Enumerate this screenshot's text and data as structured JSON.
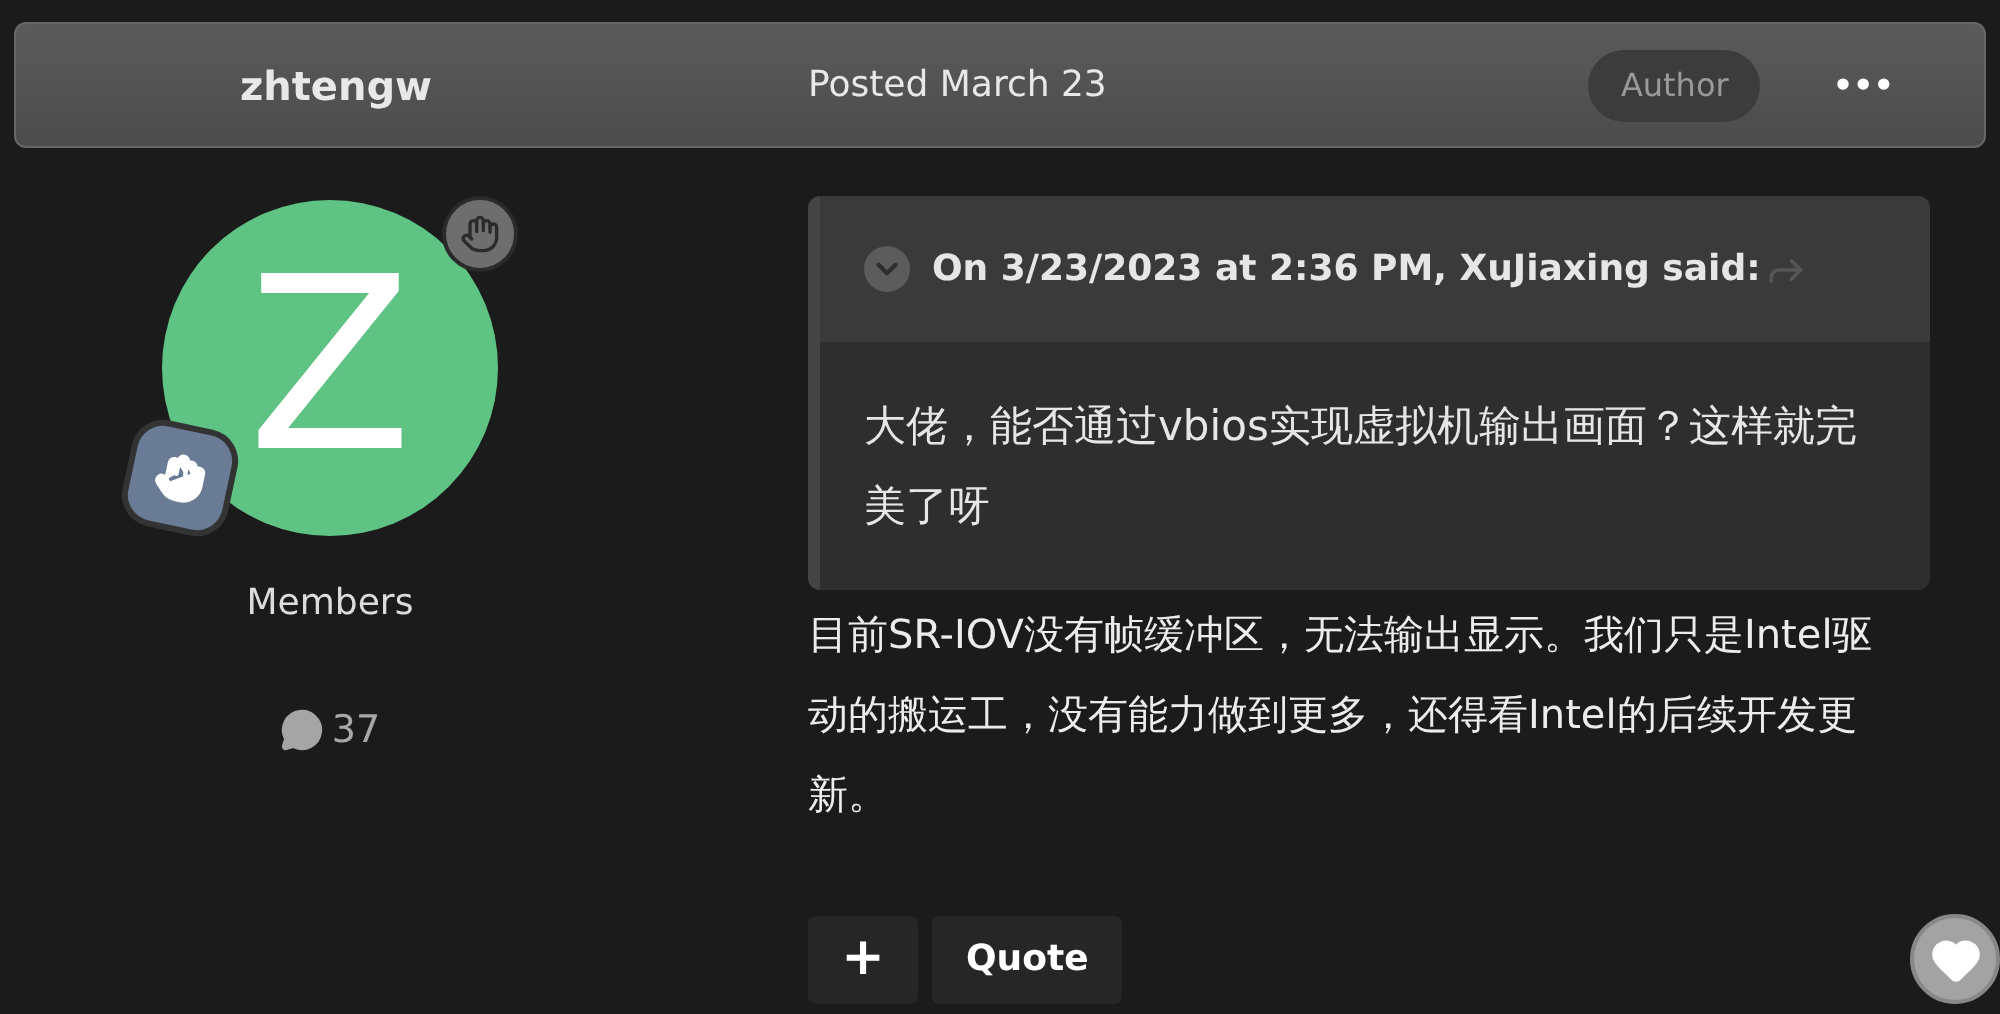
{
  "header": {
    "author": "zhtengw",
    "posted": "Posted March 23",
    "badge": "Author",
    "menu": "•••"
  },
  "profile": {
    "avatar_letter": "Z",
    "group": "Members",
    "post_count": "37"
  },
  "quote": {
    "citation": "On 3/23/2023 at 2:36 PM, XuJiaxing said:",
    "expanded": true,
    "text": "大佬，能否通过vbios实现虚拟机输出画面？这样就完美了呀"
  },
  "body": "目前SR-IOV没有帧缓冲区，无法输出显示。我们只是Intel驱动的搬运工，没有能力做到更多，还得看Intel的后续开发更新。",
  "actions": [
    {
      "label": "+",
      "kind": "icon"
    },
    {
      "label": "Quote",
      "kind": "text"
    }
  ],
  "liked": false
}
